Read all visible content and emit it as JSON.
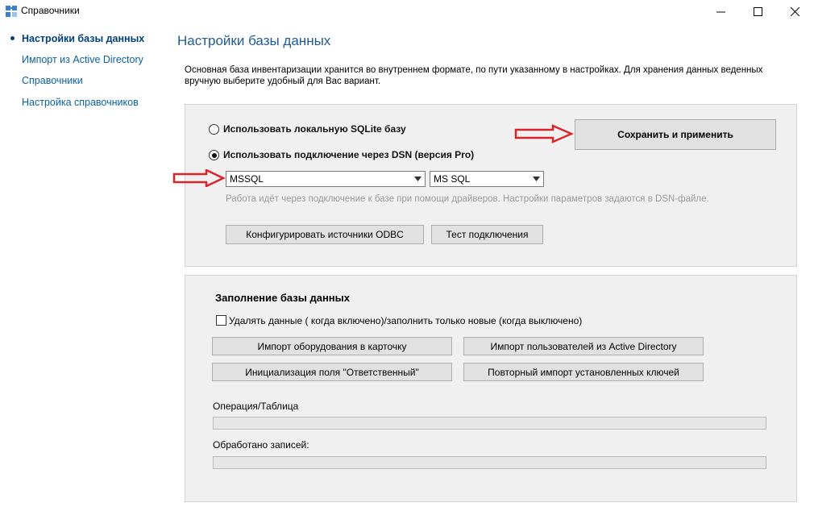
{
  "window": {
    "title": "Справочники",
    "minimize": "—",
    "maximize": "☐",
    "close": "✕"
  },
  "nav": {
    "items": [
      {
        "label": "Настройки базы данных",
        "active": true
      },
      {
        "label": "Импорт из Active Directory",
        "active": false
      },
      {
        "label": "Справочники",
        "active": false
      },
      {
        "label": "Настройка справочников",
        "active": false
      }
    ]
  },
  "page": {
    "title": "Настройки базы данных",
    "description": "Основная база инвентаризации хранится во внутреннем формате, по пути указанному в настройках. Для хранения данных веденных вручную выберите удобный для Вас вариант."
  },
  "db_panel": {
    "radio_sqlite": "Использовать локальную SQLite базу",
    "radio_dsn": "Использовать подключение через DSN (версия Pro)",
    "selected_radio": "dsn",
    "dsn_select": {
      "value": "MSSQL"
    },
    "type_select": {
      "value": "MS SQL"
    },
    "hint": "Работа идёт через подключение к базе при помощи драйверов. Настройки параметров задаются в DSN-файле.",
    "configure_odbc_button": "Конфигурировать источники ODBC",
    "test_connection_button": "Тест подключения",
    "save_apply_button": "Сохранить и применить"
  },
  "fill_panel": {
    "title": "Заполнение базы данных",
    "checkbox_label": "Удалять данные ( когда включено)/заполнить только новые (когда выключено)",
    "checkbox_checked": false,
    "import_equipment_button": "Импорт оборудования в карточку",
    "import_users_button": "Импорт пользователей из Active Directory",
    "init_responsible_button": "Инициализация поля \"Ответственный\"",
    "reimport_keys_button": "Повторный импорт установленных ключей",
    "operation_label": "Операция/Таблица",
    "operation_progress": 0,
    "processed_label": "Обработано записей:",
    "processed_progress": 0
  },
  "colors": {
    "accent_red_arrow": "#d9242b",
    "link_blue": "#0b61a4",
    "title_blue": "#1f5a97"
  },
  "icons": [
    "app-icon",
    "bullet-icon",
    "arrow-right-icon",
    "chevron-down-icon"
  ]
}
